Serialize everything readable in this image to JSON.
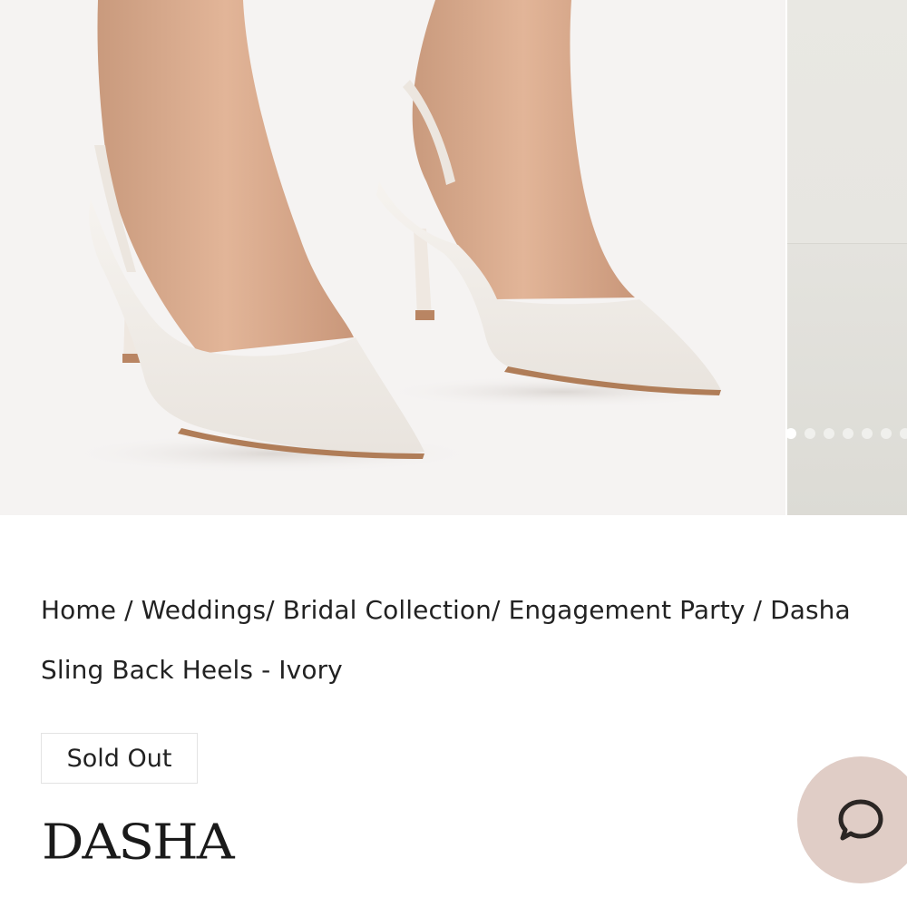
{
  "gallery": {
    "image_alt": "Dasha Sling Back Heels - Ivory",
    "dots": [
      {
        "active": true
      },
      {
        "active": false
      },
      {
        "active": false
      },
      {
        "active": false
      },
      {
        "active": false
      },
      {
        "active": false
      },
      {
        "active": false
      }
    ]
  },
  "breadcrumb": {
    "items": [
      "Home",
      "Weddings",
      "Bridal Collection",
      "Engagement Party",
      "Dasha Sling Back Heels - Ivory"
    ],
    "separators": [
      " / ",
      "/ ",
      "/ ",
      " / "
    ]
  },
  "status_badge": "Sold Out",
  "brand": "DASHA",
  "chat": {
    "icon": "chat-bubble-icon",
    "bg_color": "#e0cdc6"
  }
}
